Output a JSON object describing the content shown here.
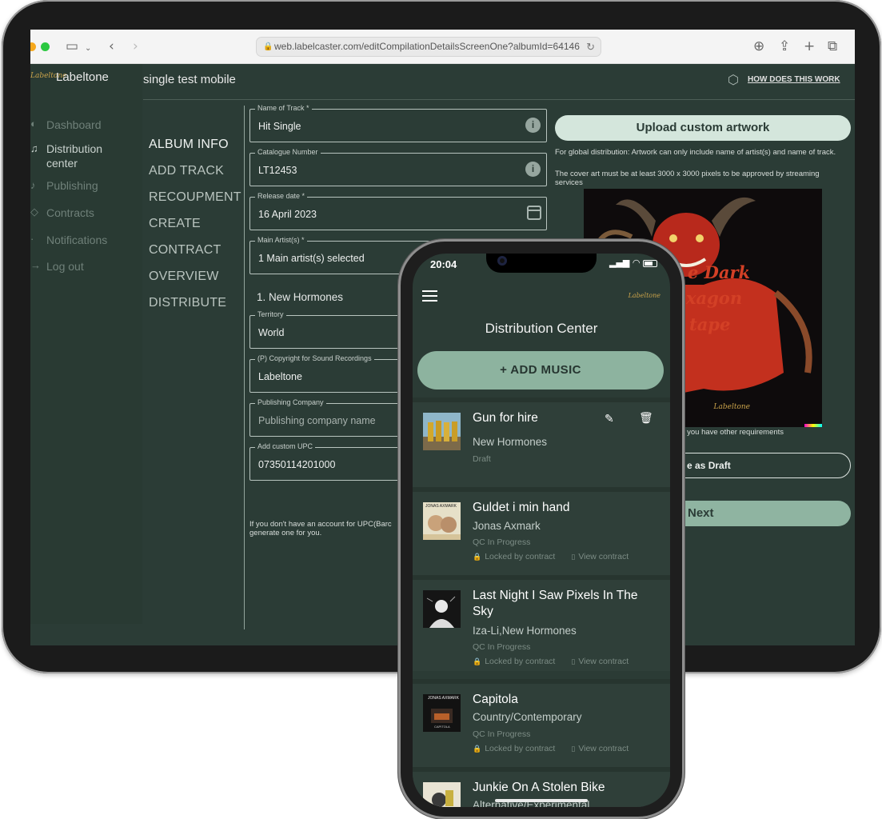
{
  "browser": {
    "url": "web.labelcaster.com/editCompilationDetailsScreenOne?albumId=64146"
  },
  "desktop": {
    "brand": "Labeltone",
    "logo_text": "Labeltone",
    "page_title": "single test mobile",
    "how_link": "HOW DOES THIS WORK",
    "sidebar": [
      {
        "label": "Dashboard"
      },
      {
        "label": "Distribution center"
      },
      {
        "label": "Publishing"
      },
      {
        "label": "Contracts"
      },
      {
        "label": "Notifications"
      },
      {
        "label": "Log out"
      }
    ],
    "steps": [
      "ALBUM INFO",
      "ADD TRACK",
      "RECOUPMENT",
      "CREATE",
      "CONTRACT",
      "OVERVIEW",
      "DISTRIBUTE"
    ],
    "fields": {
      "track_name": {
        "label": "Name of Track *",
        "value": "Hit Single"
      },
      "catalogue": {
        "label": "Catalogue Number",
        "value": "LT12453"
      },
      "release": {
        "label": "Release date *",
        "value": "16 April 2023"
      },
      "main_artist": {
        "label": "Main Artist(s) *",
        "value": "1 Main artist(s) selected"
      },
      "territory": {
        "label": "Territory",
        "value": "World"
      },
      "copyright": {
        "label": "(P) Copyright for Sound Recordings",
        "value": "Labeltone"
      },
      "publishing": {
        "label": "Publishing Company",
        "placeholder": "Publishing company name"
      },
      "upc": {
        "label": "Add custom UPC",
        "value": "07350114201000"
      }
    },
    "artist_section": "1. New Hormones",
    "upc_note": "If you don't have an account for UPC(Barc generate one for you.",
    "upload_button": "Upload custom artwork",
    "art_note_1": "For global distribution: Artwork can only include name of artist(s) and name of track.",
    "art_note_2": "The cover art must be at least 3000 x 3000 pixels to be approved by streaming services",
    "art_text": [
      "e Dark",
      "xagon",
      "tape"
    ],
    "art_signature": "Labeltone",
    "req_note": "ter if you have other requirements",
    "draft_button": "e as Draft",
    "next_button": "Next"
  },
  "mobile": {
    "time": "20:04",
    "logo_text": "Labeltone",
    "title": "Distribution Center",
    "add_button": "+ ADD MUSIC",
    "tracks": [
      {
        "title": "Gun for hire",
        "artist": "New Hormones",
        "status": "Draft"
      },
      {
        "title": "Guldet i min hand",
        "artist": "Jonas Axmark",
        "status": "QC In Progress",
        "lock": "Locked by contract",
        "view": "View contract",
        "thumb_text": "JONAS AXMARK"
      },
      {
        "title": "Last Night I Saw Pixels In The Sky",
        "artist": "Iza-Li,New Hormones",
        "status": "QC In Progress",
        "lock": "Locked by contract",
        "view": "View contract"
      },
      {
        "title": "Capitola",
        "artist": "Country/Contemporary",
        "status": "QC In Progress",
        "lock": "Locked by contract",
        "view": "View contract",
        "thumb_text": "JONAS AXMARK",
        "thumb_sub": "CAPITOLA"
      },
      {
        "title": "Junkie On A Stolen Bike",
        "artist": "Alternative/Experimental"
      }
    ]
  }
}
